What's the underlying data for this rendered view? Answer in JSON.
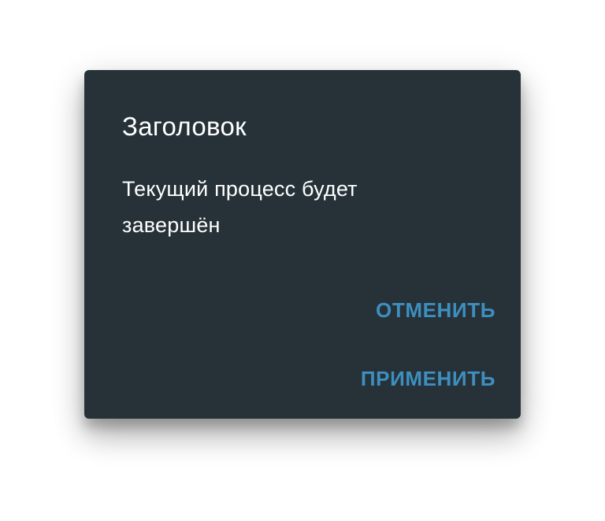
{
  "dialog": {
    "title": "Заголовок",
    "message": "Текущий процесс будет завершён",
    "actions": {
      "cancel_label": "ОТМЕНИТЬ",
      "apply_label": "ПРИМЕНИТЬ"
    }
  },
  "colors": {
    "dialog_background": "#263238",
    "text": "#ffffff",
    "accent": "#3d8fc0",
    "page_background": "#ffffff"
  }
}
